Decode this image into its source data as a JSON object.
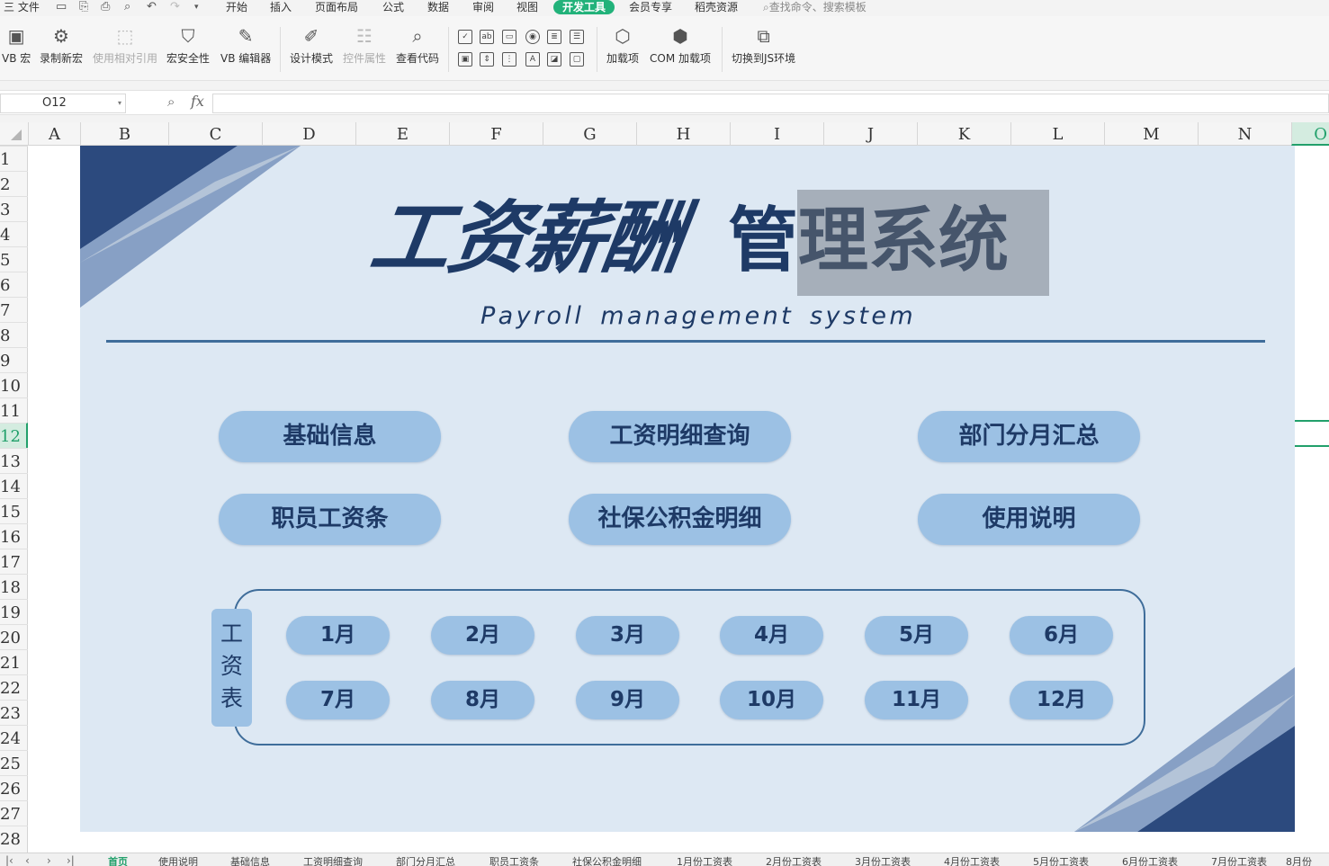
{
  "menubar": {
    "file": "三 文件",
    "tabs": [
      "开始",
      "插入",
      "页面布局",
      "公式",
      "数据",
      "审阅",
      "视图",
      "开发工具",
      "会员专享",
      "稻壳资源"
    ],
    "active_tab": "开发工具",
    "search_placeholder": "查找命令、搜索模板"
  },
  "ribbon": {
    "vb_macro": "VB 宏",
    "record_macro": "录制新宏",
    "relative_ref": "使用相对引用",
    "macro_security": "宏安全性",
    "vb_editor": "VB 编辑器",
    "design_mode": "设计模式",
    "control_props": "控件属性",
    "view_code": "查看代码",
    "add_ins": "加载项",
    "com_add_ins": "COM 加载项",
    "js_env": "切换到JS环境"
  },
  "formula_bar": {
    "name_box": "O12",
    "fx": "fx",
    "formula": ""
  },
  "columns": [
    "A",
    "B",
    "C",
    "D",
    "E",
    "F",
    "G",
    "H",
    "I",
    "J",
    "K",
    "L",
    "M",
    "N",
    "O"
  ],
  "selected_column": "O",
  "rows": [
    "1",
    "2",
    "3",
    "4",
    "5",
    "6",
    "7",
    "8",
    "9",
    "10",
    "11",
    "12",
    "13",
    "14",
    "15",
    "16",
    "17",
    "18",
    "19",
    "20",
    "21",
    "22",
    "23",
    "24",
    "25",
    "26",
    "27",
    "28"
  ],
  "selected_row": "12",
  "dashboard": {
    "title_main": "工资薪酬",
    "title_sub_a": "管",
    "title_sub_b": "理系统",
    "title_en": "Payroll  management  system",
    "buttons": [
      "基础信息",
      "工资明细查询",
      "部门分月汇总",
      "职员工资条",
      "社保公积金明细",
      "使用说明"
    ],
    "month_label": [
      "工",
      "资",
      "表"
    ],
    "months": [
      "1月",
      "2月",
      "3月",
      "4月",
      "5月",
      "6月",
      "7月",
      "8月",
      "9月",
      "10月",
      "11月",
      "12月"
    ],
    "colors": {
      "navy": "#1e3a66",
      "pill": "#9cc1e4",
      "bg": "#dde8f3",
      "accent": "#22a06b"
    }
  },
  "sheet_tabs": [
    "首页",
    "使用说明",
    "基础信息",
    "工资明细查询",
    "部门分月汇总",
    "职员工资条",
    "社保公积金明细",
    "1月份工资表",
    "2月份工资表",
    "3月份工资表",
    "4月份工资表",
    "5月份工资表",
    "6月份工资表",
    "7月份工资表",
    "8月份"
  ],
  "active_sheet": "首页"
}
